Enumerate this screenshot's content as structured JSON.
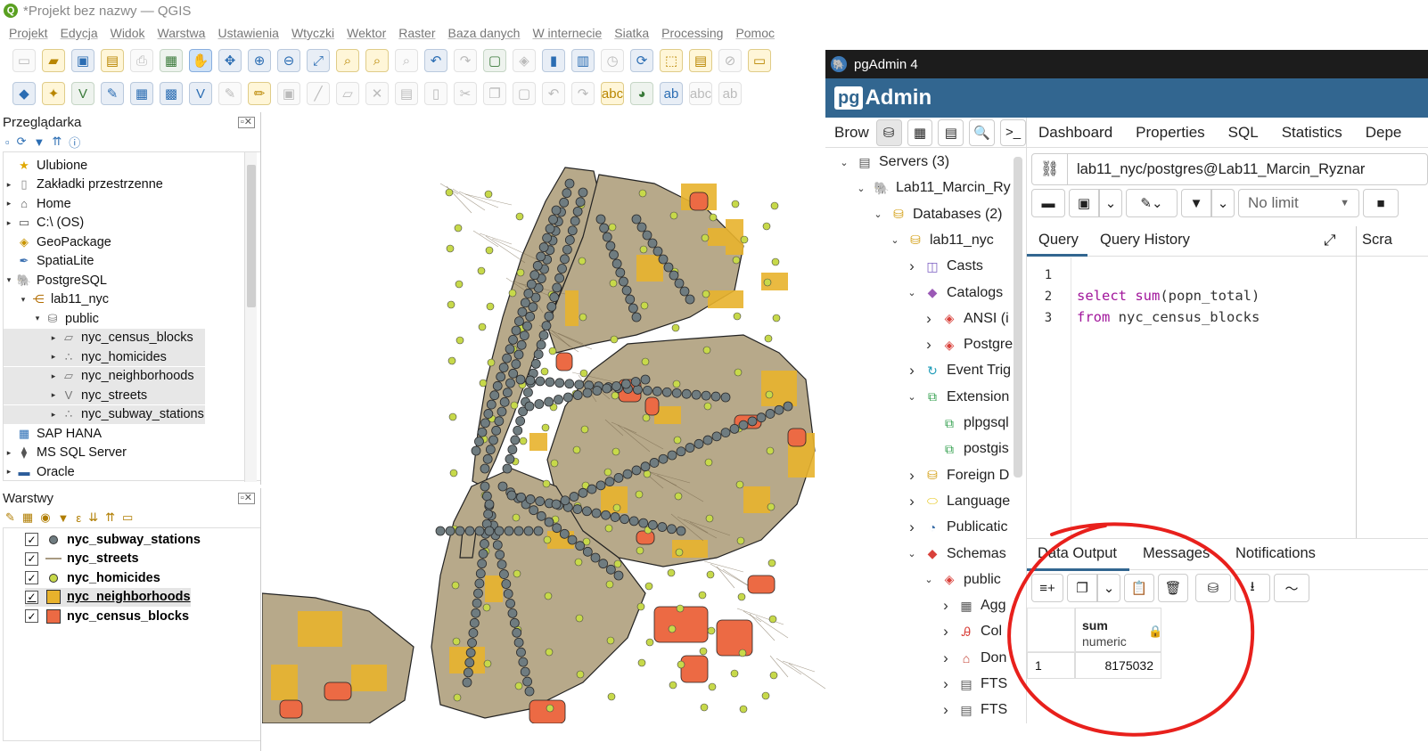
{
  "qgis": {
    "title": "*Projekt bez nazwy — QGIS",
    "menu": [
      "Projekt",
      "Edycja",
      "Widok",
      "Warstwa",
      "Ustawienia",
      "Wtyczki",
      "Wektor",
      "Raster",
      "Baza danych",
      "W internecie",
      "Siatka",
      "Processing",
      "Pomoc"
    ],
    "browser": {
      "title": "Przeglądarka",
      "items": [
        {
          "label": "Ulubione",
          "icon": "star-icon"
        },
        {
          "label": "Zakładki przestrzenne",
          "icon": "bookmark-icon"
        },
        {
          "label": "Home",
          "icon": "home-icon"
        },
        {
          "label": "C:\\ (OS)",
          "icon": "drive-icon"
        },
        {
          "label": "GeoPackage",
          "icon": "geopackage-icon"
        },
        {
          "label": "SpatiaLite",
          "icon": "spatialite-icon"
        },
        {
          "label": "PostgreSQL",
          "icon": "elephant-icon"
        },
        {
          "label": "lab11_nyc",
          "icon": "connection-icon"
        },
        {
          "label": "public",
          "icon": "schema-icon"
        },
        {
          "label": "nyc_census_blocks",
          "icon": "polygon-layer-icon"
        },
        {
          "label": "nyc_homicides",
          "icon": "point-layer-icon"
        },
        {
          "label": "nyc_neighborhoods",
          "icon": "polygon-layer-icon"
        },
        {
          "label": "nyc_streets",
          "icon": "line-layer-icon"
        },
        {
          "label": "nyc_subway_stations",
          "icon": "point-layer-icon"
        },
        {
          "label": "SAP HANA",
          "icon": "hana-icon"
        },
        {
          "label": "MS SQL Server",
          "icon": "mssql-icon"
        },
        {
          "label": "Oracle",
          "icon": "oracle-icon"
        }
      ]
    },
    "layers": {
      "title": "Warstwy",
      "items": [
        {
          "label": "nyc_subway_stations",
          "symbol": "point",
          "color": "#6f7c80"
        },
        {
          "label": "nyc_streets",
          "symbol": "line",
          "color": "#a89a82"
        },
        {
          "label": "nyc_homicides",
          "symbol": "point",
          "color": "#c7d94a"
        },
        {
          "label": "nyc_neighborhoods",
          "symbol": "fill",
          "color": "#e8b22c"
        },
        {
          "label": "nyc_census_blocks",
          "symbol": "fill",
          "color": "#ec6a44"
        }
      ]
    },
    "colors": {
      "land": "#b7a98a",
      "neighborhood": "#e8b22c",
      "census": "#ec6a44",
      "station": "#6f7c80",
      "homicide": "#c7d94a"
    }
  },
  "pgadmin": {
    "window_title": "pgAdmin 4",
    "brand_left": "pg",
    "brand_right": "Admin",
    "left_tab": "Brow",
    "tree": [
      {
        "label": "Servers (3)",
        "level": 0,
        "arrow": "down",
        "icon": "servers-icon"
      },
      {
        "label": "Lab11_Marcin_Ry",
        "level": 1,
        "arrow": "down",
        "icon": "elephant-icon"
      },
      {
        "label": "Databases (2)",
        "level": 2,
        "arrow": "down",
        "icon": "database-icon"
      },
      {
        "label": "lab11_nyc",
        "level": 3,
        "arrow": "down",
        "icon": "database-icon"
      },
      {
        "label": "Casts",
        "level": 4,
        "arrow": "right",
        "icon": "casts-icon"
      },
      {
        "label": "Catalogs",
        "level": 4,
        "arrow": "down",
        "icon": "catalogs-icon"
      },
      {
        "label": "ANSI (i",
        "level": 5,
        "arrow": "right",
        "icon": "catalog-icon"
      },
      {
        "label": "Postgre",
        "level": 5,
        "arrow": "right",
        "icon": "catalog-icon"
      },
      {
        "label": "Event Trig",
        "level": 4,
        "arrow": "right",
        "icon": "event-trigger-icon"
      },
      {
        "label": "Extension",
        "level": 4,
        "arrow": "down",
        "icon": "extension-icon"
      },
      {
        "label": "plpgsql",
        "level": 5,
        "arrow": "none",
        "icon": "extension-icon"
      },
      {
        "label": "postgis",
        "level": 5,
        "arrow": "none",
        "icon": "extension-icon"
      },
      {
        "label": "Foreign D",
        "level": 4,
        "arrow": "right",
        "icon": "foreign-data-icon"
      },
      {
        "label": "Language",
        "level": 4,
        "arrow": "right",
        "icon": "language-icon"
      },
      {
        "label": "Publicatic",
        "level": 4,
        "arrow": "right",
        "icon": "publication-icon"
      },
      {
        "label": "Schemas",
        "level": 4,
        "arrow": "down",
        "icon": "schemas-icon"
      },
      {
        "label": "public",
        "level": 5,
        "arrow": "down",
        "icon": "schema-icon"
      },
      {
        "label": "Agg",
        "level": 6,
        "arrow": "right",
        "icon": "aggregate-icon"
      },
      {
        "label": "Col",
        "level": 6,
        "arrow": "right",
        "icon": "collation-icon"
      },
      {
        "label": "Don",
        "level": 6,
        "arrow": "right",
        "icon": "domain-icon"
      },
      {
        "label": "FTS",
        "level": 6,
        "arrow": "right",
        "icon": "fts-icon"
      },
      {
        "label": "FTS",
        "level": 6,
        "arrow": "right",
        "icon": "fts-icon"
      }
    ],
    "main_tabs": [
      "Dashboard",
      "Properties",
      "SQL",
      "Statistics",
      "Depe"
    ],
    "connection": "lab11_nyc/postgres@Lab11_Marcin_Ryznar",
    "limit": "No limit",
    "query_tabs": [
      "Query",
      "Query History"
    ],
    "scratch_tab": "Scra",
    "editor": {
      "line_numbers": [
        "1",
        "2",
        "3"
      ],
      "line2_kw1": "select",
      "line2_fn": "sum",
      "line2_rest": "(popn_total)",
      "line3_kw": "from",
      "line3_rest": " nyc_census_blocks"
    },
    "output_tabs": [
      "Data Output",
      "Messages",
      "Notifications"
    ],
    "result": {
      "column": "sum",
      "type": "numeric",
      "row_number": "1",
      "value": "8175032"
    }
  },
  "annotation": {
    "color": "#e8201c"
  }
}
